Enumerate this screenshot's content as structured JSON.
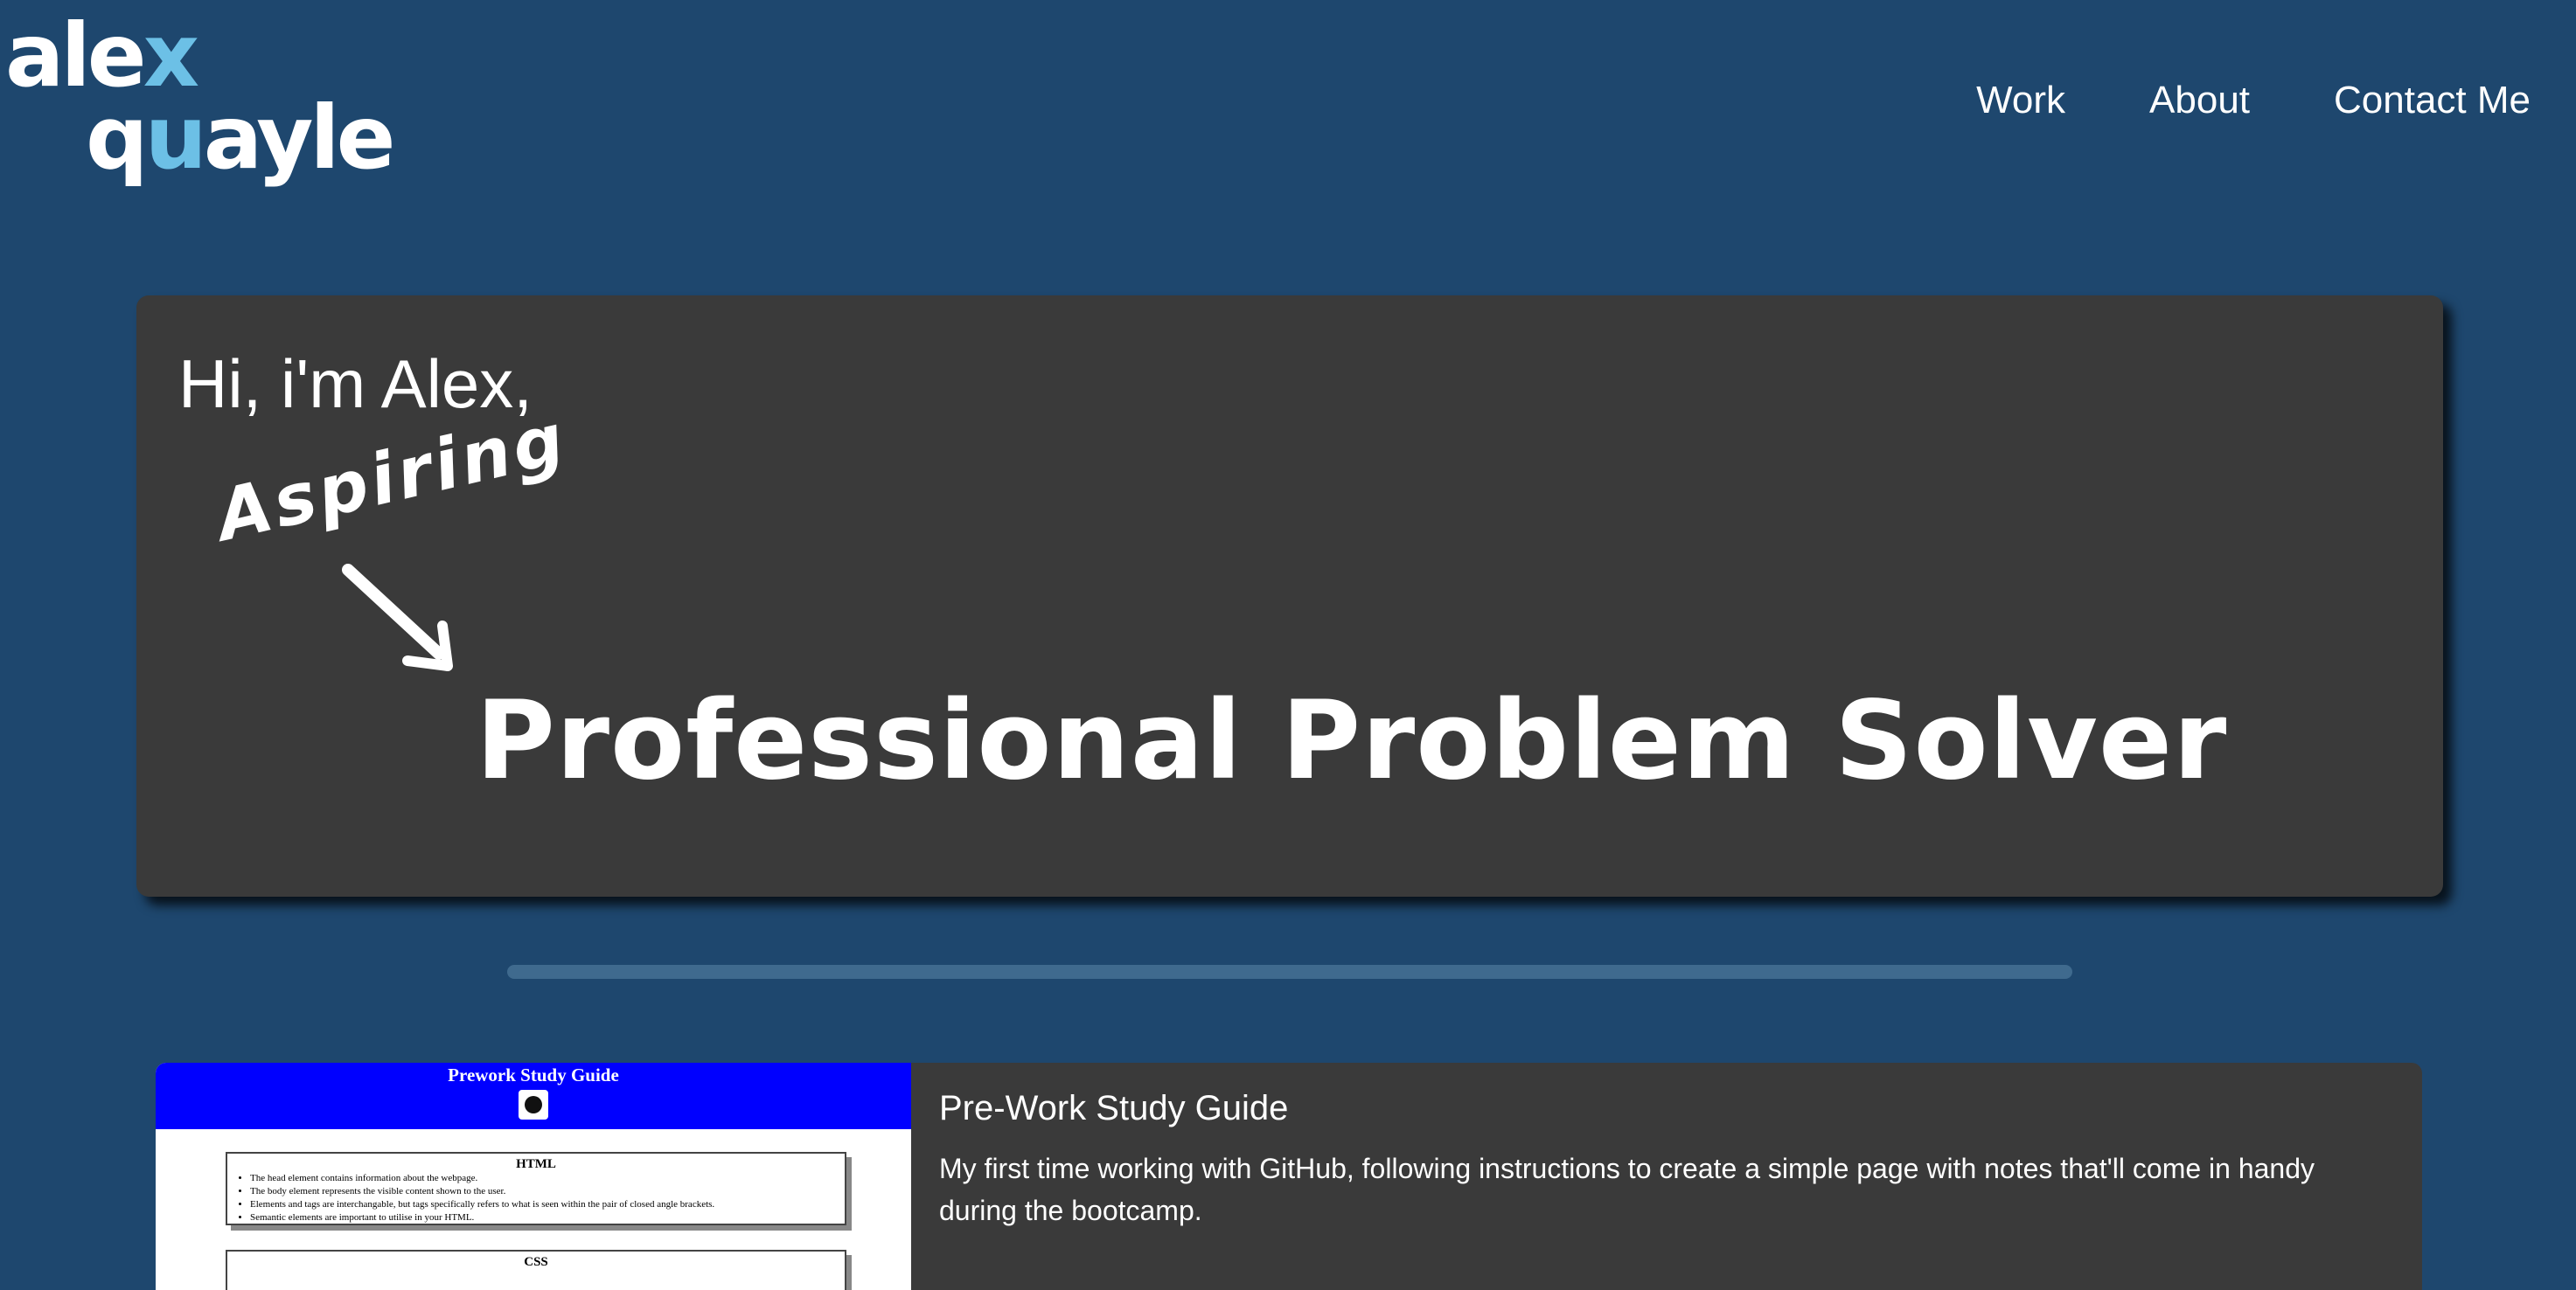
{
  "logo": {
    "line1_main": "ale",
    "line1_accent": "x",
    "line2_start": "q",
    "line2_accent": "u",
    "line2_end": "ayle",
    "accent_color": "#6cc0e6"
  },
  "nav": {
    "items": [
      {
        "label": "Work"
      },
      {
        "label": "About"
      },
      {
        "label": "Contact Me"
      }
    ]
  },
  "hero": {
    "greeting": "Hi, i'm Alex,",
    "aspiring": "Aspiring",
    "headline": "Professional Problem Solver"
  },
  "project": {
    "title": "Pre-Work Study Guide",
    "description": "My first time working with GitHub, following instructions to create a simple page with notes that'll come in handy during the bootcamp.",
    "thumbnail": {
      "title": "Prework Study Guide",
      "html_heading": "HTML",
      "html_notes": [
        "The head element contains information about the webpage.",
        "The body element represents the visible content shown to the user.",
        "Elements and tags are interchangable, but tags specifically refers to what is seen within the pair of closed angle brackets.",
        "Semantic elements are important to utilise in your HTML."
      ],
      "css_heading": "CSS"
    }
  },
  "colors": {
    "background": "#1e476e",
    "card": "#3a3a3a",
    "divider": "#3f6a8e"
  }
}
